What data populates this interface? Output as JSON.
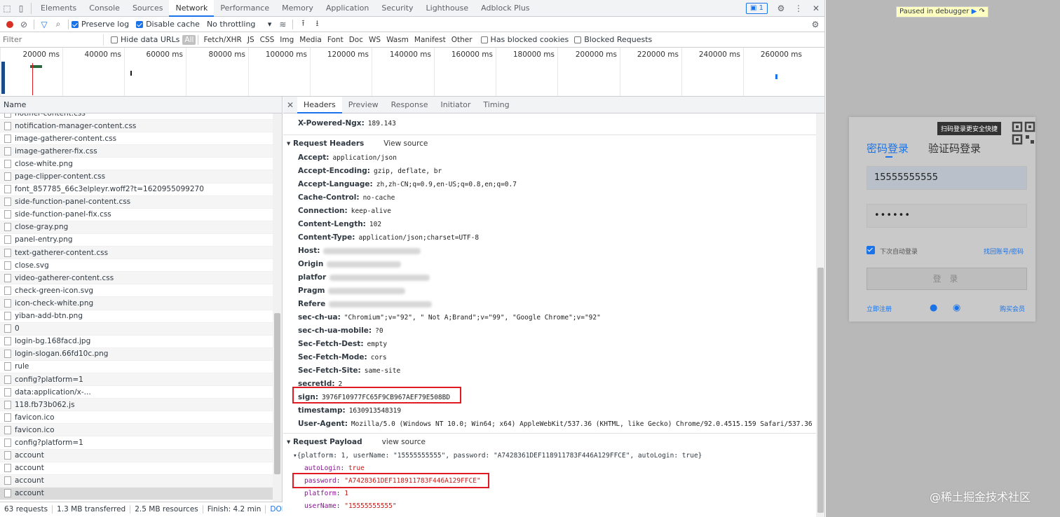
{
  "devtools": {
    "tabs": [
      "Elements",
      "Console",
      "Sources",
      "Network",
      "Performance",
      "Memory",
      "Application",
      "Security",
      "Lighthouse",
      "Adblock Plus"
    ],
    "issues_badge": "1",
    "toolbar": {
      "preserve_log": "Preserve log",
      "disable_cache": "Disable cache",
      "throttling": "No throttling"
    },
    "filter": {
      "placeholder": "Filter",
      "hide_data_urls": "Hide data URLs",
      "types": [
        "All",
        "Fetch/XHR",
        "JS",
        "CSS",
        "Img",
        "Media",
        "Font",
        "Doc",
        "WS",
        "Wasm",
        "Manifest",
        "Other"
      ],
      "blocked_cookies": "Has blocked cookies",
      "blocked_requests": "Blocked Requests"
    },
    "overview_ticks": [
      "20000 ms",
      "40000 ms",
      "60000 ms",
      "80000 ms",
      "100000 ms",
      "120000 ms",
      "140000 ms",
      "160000 ms",
      "180000 ms",
      "200000 ms",
      "220000 ms",
      "240000 ms",
      "260000 ms"
    ],
    "name_header": "Name",
    "requests": [
      "notifier-content.css",
      "notification-manager-content.css",
      "image-gatherer-content.css",
      "image-gatherer-fix.css",
      "close-white.png",
      "page-clipper-content.css",
      "font_857785_66c3elpleyr.woff2?t=1620955099270",
      "side-function-panel-content.css",
      "side-function-panel-fix.css",
      "close-gray.png",
      "panel-entry.png",
      "text-gatherer-content.css",
      "close.svg",
      "video-gatherer-content.css",
      "check-green-icon.svg",
      "icon-check-white.png",
      "yiban-add-btn.png",
      "0",
      "login-bg.168facd.jpg",
      "login-slogan.66fd10c.png",
      "rule",
      "config?platform=1",
      "data:application/x-...",
      "118.fb73b062.js",
      "favicon.ico",
      "favicon.ico",
      "config?platform=1",
      "account",
      "account",
      "account",
      "account"
    ],
    "status": [
      "63 requests",
      "1.3 MB transferred",
      "2.5 MB resources",
      "Finish: 4.2 min",
      "DOMCon"
    ],
    "detail_tabs": [
      "Headers",
      "Preview",
      "Response",
      "Initiator",
      "Timing"
    ],
    "response_header": {
      "name": "X-Powered-Ngx:",
      "value": "189.143"
    },
    "request_headers_title": "Request Headers",
    "view_source": "View source",
    "request_headers": [
      {
        "name": "Accept:",
        "value": "application/json"
      },
      {
        "name": "Accept-Encoding:",
        "value": "gzip, deflate, br"
      },
      {
        "name": "Accept-Language:",
        "value": "zh,zh-CN;q=0.9,en-US;q=0.8,en;q=0.7"
      },
      {
        "name": "Cache-Control:",
        "value": "no-cache"
      },
      {
        "name": "Connection:",
        "value": "keep-alive"
      },
      {
        "name": "Content-Length:",
        "value": "102"
      },
      {
        "name": "Content-Type:",
        "value": "application/json;charset=UTF-8"
      },
      {
        "name": "Host:",
        "value": ""
      },
      {
        "name": "Origin",
        "value": ""
      },
      {
        "name": "platfor",
        "value": ""
      },
      {
        "name": "Pragm",
        "value": ""
      },
      {
        "name": "Refere",
        "value": ""
      },
      {
        "name": "sec-ch-ua:",
        "value": "\"Chromium\";v=\"92\", \" Not A;Brand\";v=\"99\", \"Google Chrome\";v=\"92\""
      },
      {
        "name": "sec-ch-ua-mobile:",
        "value": "?0"
      },
      {
        "name": "Sec-Fetch-Dest:",
        "value": "empty"
      },
      {
        "name": "Sec-Fetch-Mode:",
        "value": "cors"
      },
      {
        "name": "Sec-Fetch-Site:",
        "value": "same-site"
      },
      {
        "name": "secretId:",
        "value": "2"
      },
      {
        "name": "sign:",
        "value": "3976F10977FC65F9CB967AEF79E508BD"
      },
      {
        "name": "timestamp:",
        "value": "1630913548319"
      },
      {
        "name": "User-Agent:",
        "value": "Mozilla/5.0 (Windows NT 10.0; Win64; x64) AppleWebKit/537.36 (KHTML, like Gecko) Chrome/92.0.4515.159 Safari/537.36"
      }
    ],
    "payload_title": "Request Payload",
    "payload_view_source": "view source",
    "payload_summary": "{platform: 1, userName: \"15555555555\", password: \"A7428361DEF118911783F446A129FFCE\", autoLogin: true}",
    "payload": [
      {
        "key": "autoLogin",
        "value": "true"
      },
      {
        "key": "password",
        "value": "\"A7428361DEF118911783F446A129FFCE\""
      },
      {
        "key": "platform",
        "value": "1"
      },
      {
        "key": "userName",
        "value": "\"15555555555\""
      }
    ]
  },
  "page": {
    "debugger": "Paused in debugger",
    "qr_tip": "扫码登录更安全快捷",
    "tab_password": "密码登录",
    "tab_code": "验证码登录",
    "phone": "15555555555",
    "password_mask": "••••••",
    "auto_login": "下次自动登录",
    "forgot": "找回账号/密码",
    "login_btn": "登 录",
    "register": "立即注册",
    "buy_vip": "购买会员",
    "watermark": "@稀土掘金技术社区"
  }
}
